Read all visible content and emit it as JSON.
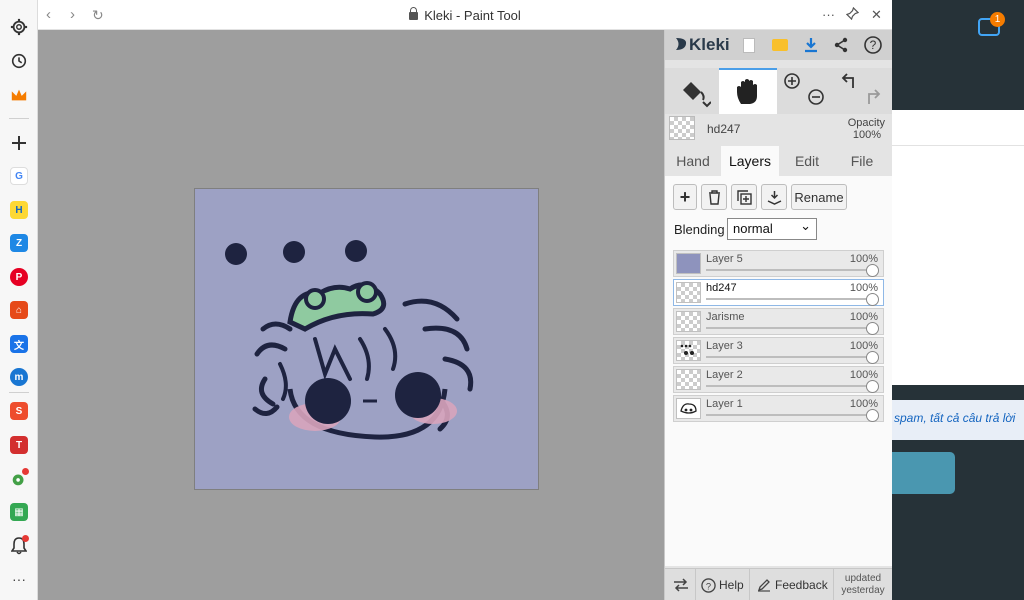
{
  "window": {
    "title": "Kleki - Paint Tool",
    "back_glyph": "‹",
    "forward_glyph": "›",
    "reload_glyph": "↻",
    "more_glyph": "···",
    "close_glyph": "✕"
  },
  "panel": {
    "brand": "Kleki",
    "current_layer_name": "hd247",
    "opacity_label": "Opacity",
    "opacity_value": "100%",
    "tabs": [
      "Hand",
      "Layers",
      "Edit",
      "File"
    ],
    "active_tab": "Layers",
    "buttons": {
      "add": "+",
      "rename": "Rename"
    },
    "blending_label": "Blending",
    "blending_value": "normal",
    "layers": [
      {
        "name": "Layer 5",
        "opacity": "100%",
        "selected": false
      },
      {
        "name": "hd247",
        "opacity": "100%",
        "selected": true
      },
      {
        "name": "Jarisme",
        "opacity": "100%",
        "selected": false
      },
      {
        "name": "Layer 3",
        "opacity": "100%",
        "selected": false
      },
      {
        "name": "Layer 2",
        "opacity": "100%",
        "selected": false
      },
      {
        "name": "Layer 1",
        "opacity": "100%",
        "selected": false
      }
    ],
    "footer": {
      "help": "Help",
      "feedback": "Feedback",
      "updated_line1": "updated",
      "updated_line2": "yesterday"
    }
  },
  "sidebar": {
    "more_glyph": "···"
  },
  "background_site": {
    "notification_count": "1",
    "text_fragment": "spam, tất cả câu trả lời"
  }
}
